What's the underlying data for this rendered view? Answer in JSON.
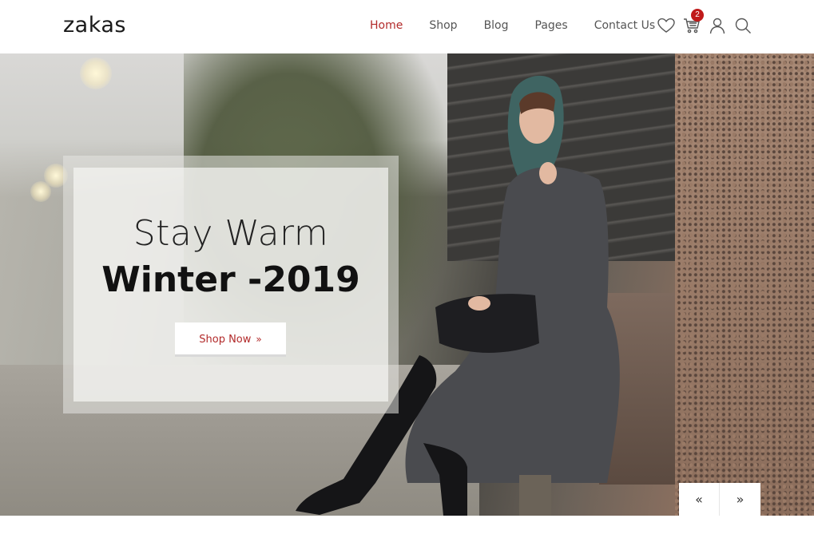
{
  "brand": {
    "logo_text": "zakas"
  },
  "nav": {
    "items": [
      {
        "label": "Home",
        "active": true
      },
      {
        "label": "Shop",
        "active": false
      },
      {
        "label": "Blog",
        "active": false
      },
      {
        "label": "Pages",
        "active": false
      },
      {
        "label": "Contact Us",
        "active": false
      }
    ]
  },
  "header_icons": {
    "wishlist": "heart-icon",
    "cart": "cart-icon",
    "cart_count": "2",
    "account": "user-icon",
    "search": "search-icon"
  },
  "hero": {
    "title_line1": "Stay Warm",
    "title_line2": "Winter -2019",
    "cta_label": "Shop Now",
    "cta_icon": "»",
    "prev_arrow": "«",
    "next_arrow": "»"
  },
  "colors": {
    "accent": "#b22a2a",
    "badge": "#c01a1a",
    "text_dark": "#111111"
  }
}
